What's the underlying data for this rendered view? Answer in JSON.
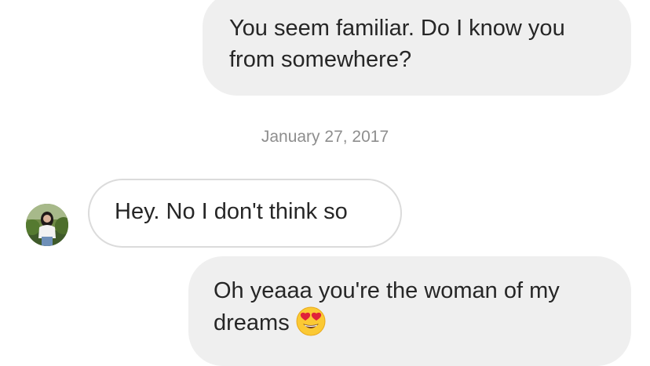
{
  "thread": {
    "date_separator": "January 27, 2017",
    "messages": [
      {
        "direction": "outgoing",
        "text": "You seem familiar. Do I know you from somewhere?"
      },
      {
        "direction": "incoming",
        "text": "Hey. No I don't think so"
      },
      {
        "direction": "outgoing",
        "text": "Oh yeaaa you're the woman of my dreams",
        "emoji": "heart-eyes-emoji"
      }
    ]
  },
  "colors": {
    "outgoing_bubble": "#efefef",
    "incoming_border": "#dbdbdb",
    "text": "#262626",
    "timestamp": "#8e8e8e"
  },
  "icons": {
    "sender_avatar": "avatar-photo",
    "emoji": "heart-eyes-emoji"
  }
}
